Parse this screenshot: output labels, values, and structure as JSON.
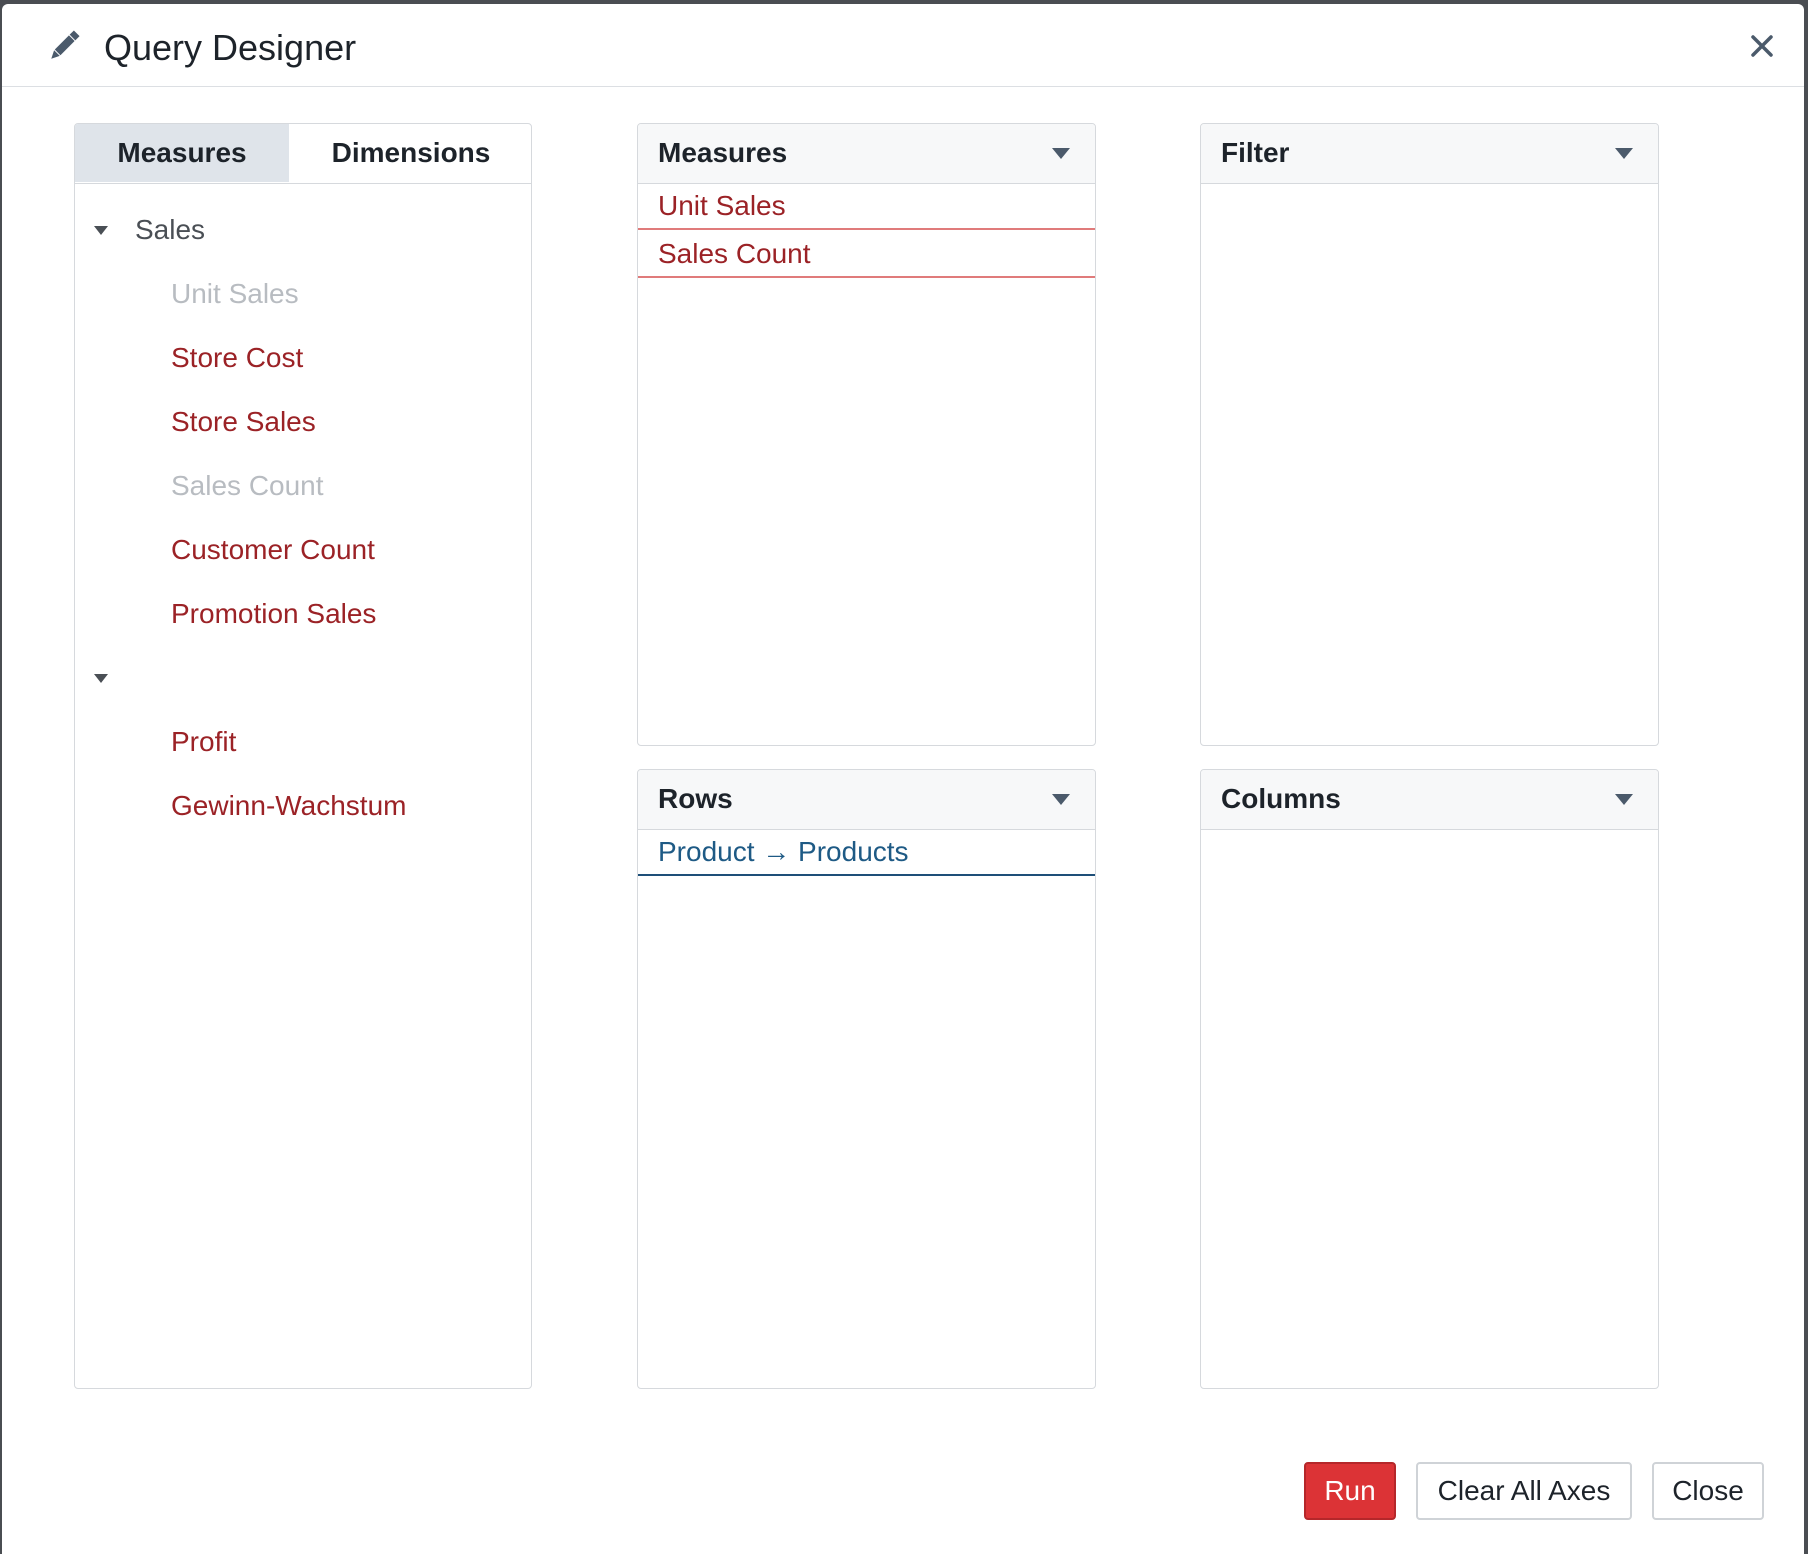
{
  "dialog": {
    "title": "Query Designer",
    "icon": "pencil-icon",
    "close_icon": "close-icon"
  },
  "source": {
    "tabs": [
      {
        "label": "Measures",
        "active": true
      },
      {
        "label": "Dimensions",
        "active": false
      }
    ],
    "groups": [
      {
        "label": "Sales",
        "expanded": true,
        "items": [
          {
            "label": "Unit Sales",
            "state": "disabled"
          },
          {
            "label": "Store Cost",
            "state": "active"
          },
          {
            "label": "Store Sales",
            "state": "active"
          },
          {
            "label": "Sales Count",
            "state": "disabled"
          },
          {
            "label": "Customer Count",
            "state": "active"
          },
          {
            "label": "Promotion Sales",
            "state": "active"
          }
        ]
      },
      {
        "label": "",
        "expanded": true,
        "items": [
          {
            "label": "Profit",
            "state": "active"
          },
          {
            "label": "Gewinn-Wachstum",
            "state": "active"
          }
        ]
      }
    ]
  },
  "axes": {
    "measures": {
      "label": "Measures",
      "items": [
        "Unit Sales",
        "Sales Count"
      ]
    },
    "filter": {
      "label": "Filter",
      "items": []
    },
    "rows": {
      "label": "Rows",
      "items": [
        "Product → Products"
      ]
    },
    "columns": {
      "label": "Columns",
      "items": []
    }
  },
  "buttons": {
    "run": "Run",
    "clear": "Clear All Axes",
    "close": "Close"
  },
  "colors": {
    "run": "#dc3336",
    "measure_text": "#9b2226",
    "dimension_text": "#1e5a85",
    "disabled_text": "#b8bcc1"
  }
}
